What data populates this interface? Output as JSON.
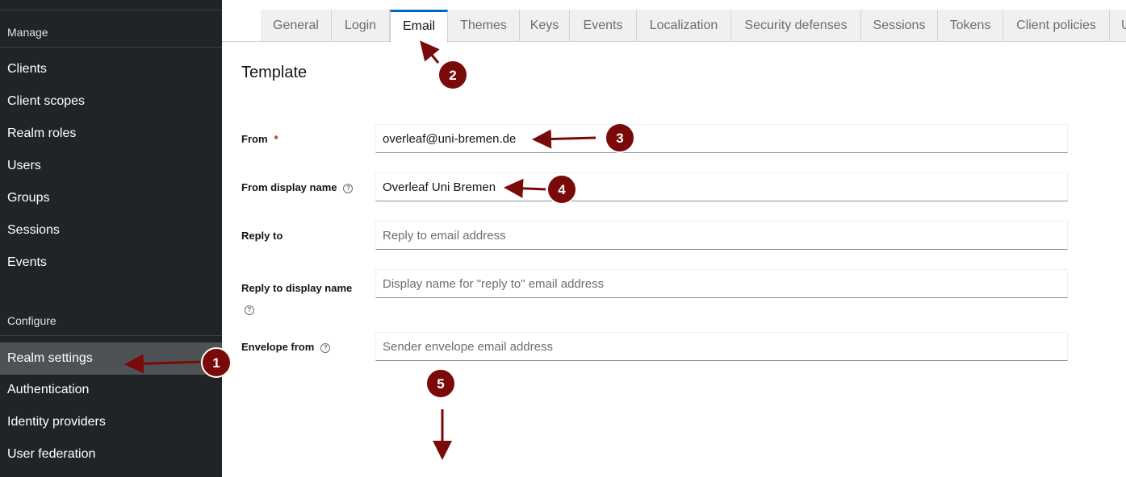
{
  "sidebar": {
    "manage_heading": "Manage",
    "manage_items": [
      "Clients",
      "Client scopes",
      "Realm roles",
      "Users",
      "Groups",
      "Sessions",
      "Events"
    ],
    "configure_heading": "Configure",
    "configure_items": [
      "Realm settings",
      "Authentication",
      "Identity providers",
      "User federation"
    ],
    "active_item": "Realm settings"
  },
  "tabs": [
    "General",
    "Login",
    "Email",
    "Themes",
    "Keys",
    "Events",
    "Localization",
    "Security defenses",
    "Sessions",
    "Tokens",
    "Client policies",
    "U"
  ],
  "active_tab": "Email",
  "section_title": "Template",
  "form": {
    "from": {
      "label": "From",
      "required_mark": "*",
      "value": "overleaf@uni-bremen.de"
    },
    "from_display_name": {
      "label": "From display name",
      "value": "Overleaf Uni Bremen"
    },
    "reply_to": {
      "label": "Reply to",
      "placeholder": "Reply to email address"
    },
    "reply_to_display_name": {
      "label": "Reply to display name",
      "placeholder": "Display name for \"reply to\" email address"
    },
    "envelope_from": {
      "label": "Envelope from",
      "placeholder": "Sender envelope email address"
    }
  },
  "help_glyph": "?",
  "annotations": [
    "1",
    "2",
    "3",
    "4",
    "5"
  ],
  "colors": {
    "accent": "#0066cc",
    "annotation": "#7a0a0a",
    "sidebar": "#212427"
  }
}
